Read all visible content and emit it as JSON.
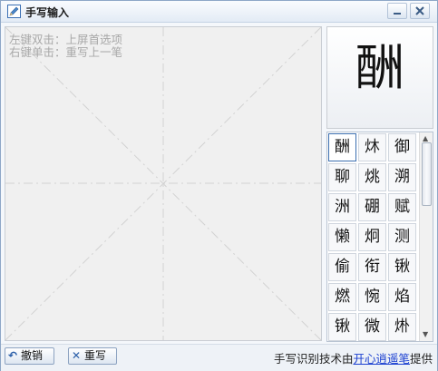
{
  "window": {
    "title": "手写输入",
    "icon": "pen-edit-icon",
    "controls": {
      "minimize": "minimize-icon",
      "close": "close-icon"
    }
  },
  "pad": {
    "hint_line1": "左键双击：上屏首选项",
    "hint_line2": "右键单击：重写上一笔"
  },
  "preview": {
    "char": "酬"
  },
  "candidates": {
    "items": [
      "酬",
      "炑",
      "御",
      "聊",
      "烑",
      "溯",
      "洲",
      "硼",
      "赋",
      "懒",
      "炯",
      "测",
      "偷",
      "衔",
      "锹",
      "燃",
      "惋",
      "焰",
      "锹",
      "微",
      "烞"
    ],
    "selected_index": 0
  },
  "toolbar": {
    "undo_label": "撤销",
    "rewrite_label": "重写"
  },
  "credit": {
    "prefix": "手写识别技术由",
    "link": "开心逍遥笔",
    "suffix": "提供"
  },
  "colors": {
    "link": "#1a3fd0",
    "hint": "#a8a8a8",
    "selected_border": "#3c6fb0"
  }
}
